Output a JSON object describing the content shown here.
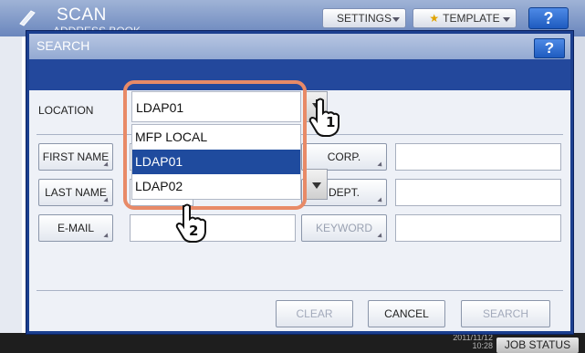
{
  "app": {
    "title": "SCAN",
    "subtitle": "ADDRESS BOOK",
    "settings_label": "SETTINGS",
    "template_label": "TEMPLATE",
    "help_label": "?",
    "datetime": "2011/11/12 10:28",
    "job_status_label": "JOB STATUS"
  },
  "dialog": {
    "title": "SEARCH",
    "help_label": "?",
    "location": {
      "label": "LOCATION",
      "selected_value": "LDAP01",
      "options": [
        {
          "label": "MFP LOCAL",
          "selected": false
        },
        {
          "label": "LDAP01",
          "selected": true
        },
        {
          "label": "LDAP02",
          "selected": false
        }
      ]
    },
    "fields": {
      "first_name": "FIRST NAME",
      "last_name": "LAST NAME",
      "email": "E-MAIL",
      "corp": "CORP.",
      "dept": "DEPT.",
      "keyword": "KEYWORD"
    },
    "buttons": {
      "clear": "CLEAR",
      "cancel": "CANCEL",
      "search": "SEARCH"
    }
  },
  "callouts": {
    "step1": "1",
    "step2": "2"
  },
  "colors": {
    "dialog_frame": "#1b3f8f",
    "selection": "#1f4b9e",
    "highlight_frame": "#e88a67"
  }
}
